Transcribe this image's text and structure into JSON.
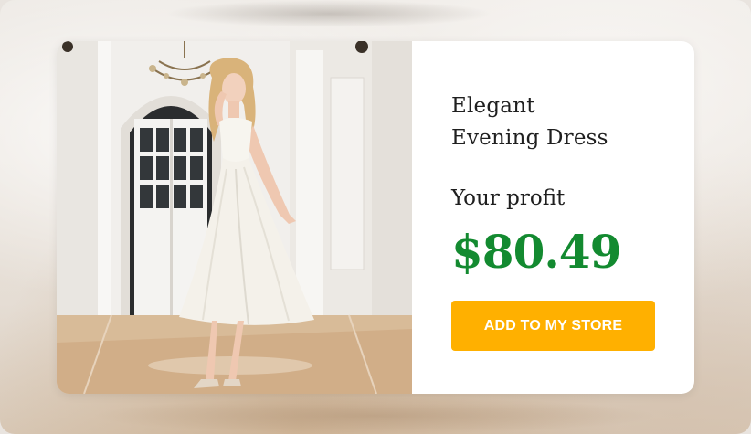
{
  "product": {
    "image_alt": "Model wearing white sleeveless midi dress in a bright hallway",
    "title_line1": "Elegant",
    "title_line2": "Evening Dress",
    "profit_label": "Your profit",
    "price": "$80.49",
    "add_button_label": "ADD TO MY STORE"
  },
  "colors": {
    "price": "#138a30",
    "button": "#ffb000",
    "button_text": "#ffffff",
    "card": "#ffffff"
  }
}
